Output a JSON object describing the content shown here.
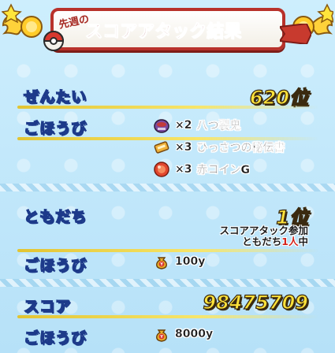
{
  "header": {
    "subtitle": "先週の",
    "title": "スコアアタック結果"
  },
  "overall": {
    "label": "ぜんたい",
    "rank": "620位"
  },
  "overall_rewards": {
    "label": "ごほうび",
    "items": [
      {
        "icon": "oni-mask-icon",
        "count": "×2",
        "name": "八つ裂鬼"
      },
      {
        "icon": "scroll-icon",
        "count": "×3",
        "name": "ひっさつの秘伝書"
      },
      {
        "icon": "red-coin-icon",
        "count": "×3",
        "name": "赤コインG"
      }
    ]
  },
  "friends": {
    "label": "ともだち",
    "rank": "1位",
    "note_line1": "スコアアタック参加",
    "note_line2_prefix": "ともだち",
    "note_line2_count": "1人",
    "note_line2_suffix": "中"
  },
  "friends_rewards": {
    "label": "ごほうび",
    "items": [
      {
        "icon": "money-bag-icon",
        "name": "100y"
      }
    ]
  },
  "score": {
    "label": "スコア",
    "value": "98475709"
  },
  "score_rewards": {
    "label": "ごほうび",
    "items": [
      {
        "icon": "money-bag-icon",
        "name": "8000y"
      }
    ]
  },
  "colors": {
    "background": "#bfe6fa",
    "label_fill": "#ffe53b",
    "label_text_outline": "#1d3a8a",
    "banner_border": "#b8322b",
    "value_gold": "#ffe23a",
    "highlight_red": "#d3241c"
  }
}
